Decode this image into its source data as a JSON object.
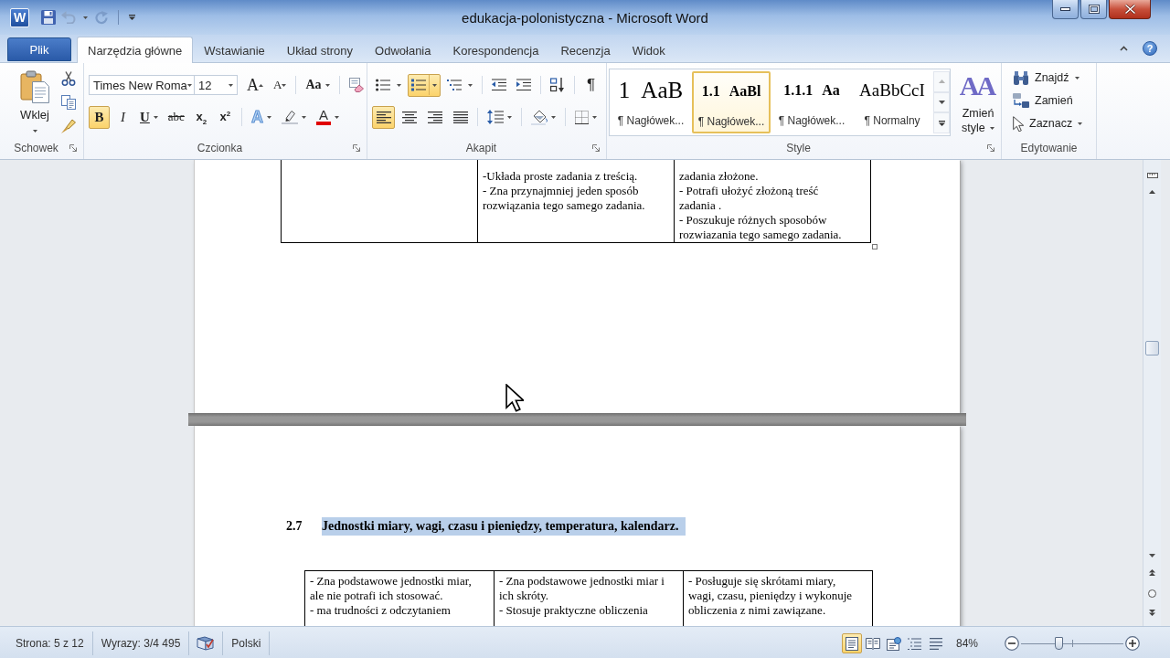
{
  "window": {
    "app_letter": "W",
    "title": "edukacja-polonistyczna - Microsoft Word"
  },
  "tabs": [
    {
      "label": "Plik",
      "kind": "file",
      "selected": false
    },
    {
      "label": "Narzędzia główne",
      "kind": "tab",
      "selected": true
    },
    {
      "label": "Wstawianie",
      "kind": "tab",
      "selected": false
    },
    {
      "label": "Układ strony",
      "kind": "tab",
      "selected": false
    },
    {
      "label": "Odwołania",
      "kind": "tab",
      "selected": false
    },
    {
      "label": "Korespondencja",
      "kind": "tab",
      "selected": false
    },
    {
      "label": "Recenzja",
      "kind": "tab",
      "selected": false
    },
    {
      "label": "Widok",
      "kind": "tab",
      "selected": false
    }
  ],
  "help": "?",
  "ribbon": {
    "clipboard": {
      "label": "Schowek",
      "paste": "Wklej"
    },
    "font": {
      "label": "Czcionka",
      "font_name": "Times New Roma",
      "font_size": "12",
      "grow": "A",
      "shrink": "A",
      "change_case": "Aa",
      "format_buttons": [
        {
          "kind": "bold",
          "glyph": "B",
          "selected": true
        },
        {
          "kind": "italic",
          "glyph": "I",
          "selected": false
        },
        {
          "kind": "underline",
          "glyph": "U",
          "selected": false
        },
        {
          "kind": "strikethrough",
          "glyph": "abc",
          "selected": false
        },
        {
          "kind": "subscript",
          "glyph": "x$_{2}$",
          "selected": false
        },
        {
          "kind": "superscript",
          "glyph": "x$^{2}$",
          "selected": false
        }
      ],
      "text_effects": "A",
      "font_color": "A"
    },
    "paragraph": {
      "label": "Akapit",
      "list_buttons": [
        {
          "kind": "bullets",
          "selected": false
        },
        {
          "kind": "numbering",
          "selected": true
        },
        {
          "kind": "multilevel",
          "selected": false
        }
      ],
      "show_marks": "¶",
      "align_buttons": [
        {
          "kind": "left",
          "selected": true
        },
        {
          "kind": "center",
          "selected": false
        },
        {
          "kind": "right",
          "selected": false
        },
        {
          "kind": "justify",
          "selected": false
        }
      ]
    },
    "styles": {
      "label": "Style",
      "gallery": [
        {
          "kind": "heading1",
          "number": "1",
          "sample": "AaB",
          "name": "¶ Nagłówek...",
          "selected": false
        },
        {
          "kind": "heading2",
          "number": "1.1",
          "sample": "AaBl",
          "name": "¶ Nagłówek...",
          "selected": true
        },
        {
          "kind": "heading3",
          "number": "1.1.1",
          "sample": "Aa",
          "name": "¶ Nagłówek...",
          "selected": false
        },
        {
          "kind": "normal",
          "sample": "AaBbCcI",
          "name": "¶ Normalny",
          "selected": false
        }
      ],
      "change_styles": {
        "glyph": "AA",
        "label": "Zmień style"
      }
    },
    "editing": {
      "label": "Edytowanie",
      "buttons": [
        {
          "kind": "find",
          "label": "Znajdź",
          "dropdown": true
        },
        {
          "kind": "replace",
          "label": "Zamień",
          "dropdown": false
        },
        {
          "kind": "select",
          "label": "Zaznacz",
          "dropdown": true
        }
      ]
    }
  },
  "document": {
    "top_table": {
      "cells": [
        {
          "kind": "blank"
        },
        {
          "kind": "text",
          "lines": [
            "-Układa proste zadania z treścią.",
            "- Zna przynajmniej jeden sposób",
            "rozwiązania tego samego zadania."
          ]
        },
        {
          "kind": "text",
          "lines": [
            "zadania złożone.",
            "- Potrafi ułożyć złożoną treść",
            "zadania .",
            "- Poszukuje różnych sposobów",
            "rozwiazania tego samego zadania."
          ]
        }
      ]
    },
    "heading": {
      "number": "2.7",
      "text": "Jednostki miary, wagi, czasu i pieniędzy, temperatura, kalendarz.",
      "selected": true
    },
    "bottom_table": {
      "cells": [
        {
          "kind": "text",
          "lines": [
            "- Zna podstawowe jednostki miar,",
            "ale nie potrafi  ich stosować.",
            "- ma trudności z odczytaniem"
          ]
        },
        {
          "kind": "text",
          "lines": [
            "- Zna podstawowe jednostki miar i",
            "ich skróty.",
            "- Stosuje praktyczne obliczenia"
          ]
        },
        {
          "kind": "text",
          "lines": [
            "- Posługuje się skrótami miary,",
            "wagi, czasu, pieniędzy i wykonuje",
            "obliczenia z nimi zawiązane."
          ]
        }
      ]
    }
  },
  "status_bar": {
    "page": "Strona: 5 z 12",
    "words": "Wyrazy: 3/4 495",
    "language": "Polski",
    "views": [
      {
        "kind": "print_layout",
        "selected": true
      },
      {
        "kind": "full_screen_reading",
        "selected": false
      },
      {
        "kind": "web_layout",
        "selected": false
      },
      {
        "kind": "outline",
        "selected": false
      },
      {
        "kind": "draft",
        "selected": false
      }
    ],
    "zoom": {
      "reading": "84%",
      "level": 0.37
    }
  }
}
